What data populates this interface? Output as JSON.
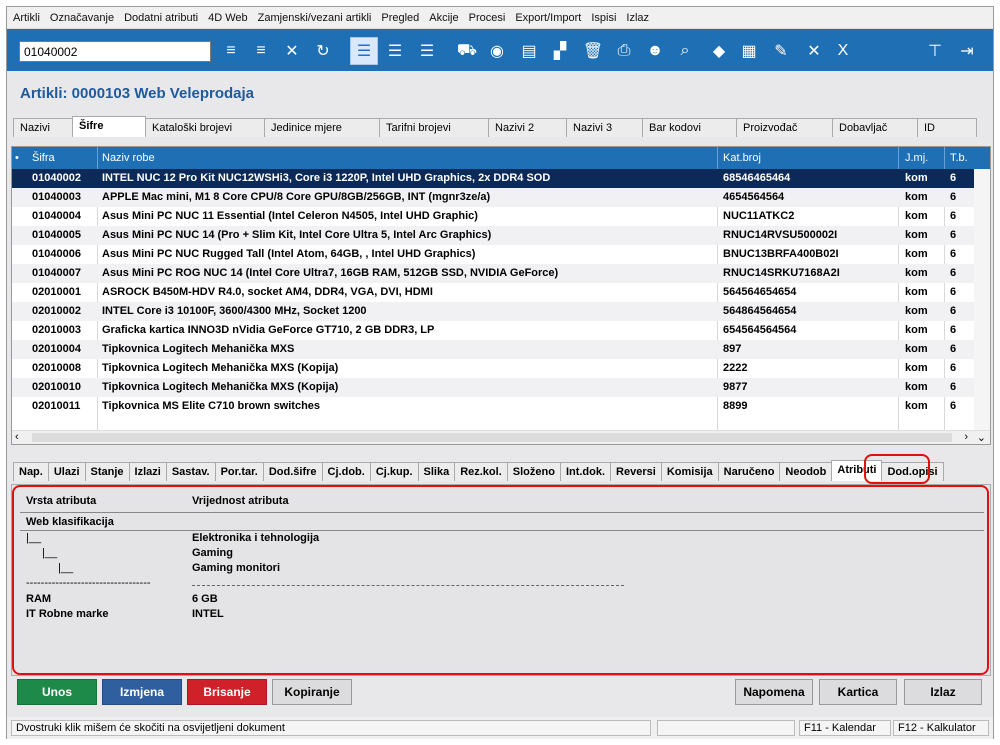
{
  "menu": [
    "Artikli",
    "Označavanje",
    "Dodatni atributi",
    "4D Web",
    "Zamjenski/vezani artikli",
    "Pregled",
    "Akcije",
    "Procesi",
    "Export/Import",
    "Ispisi",
    "Izlaz"
  ],
  "toolbar": {
    "code_value": "01040002"
  },
  "page_title": "Artikli: 0000103 Web Veleprodaja",
  "top_tabs": [
    "Nazivi",
    "Šifre",
    "Kataloški brojevi",
    "Jedinice mjere",
    "Tarifni brojevi",
    "Nazivi 2",
    "Nazivi 3",
    "Bar kodovi",
    "Proizvođač",
    "Dobavljač",
    "ID"
  ],
  "grid": {
    "headers": [
      "Šifra",
      "Naziv robe",
      "Kat.broj",
      "J.mj.",
      "T.b."
    ],
    "rows": [
      [
        "01040002",
        "INTEL NUC 12 Pro Kit NUC12WSHi3, Core i3 1220P, Intel UHD Graphics, 2x DDR4 SOD",
        "68546465464",
        "kom",
        "6"
      ],
      [
        "01040003",
        "APPLE Mac mini, M1 8 Core CPU/8 Core GPU/8GB/256GB, INT (mgnr3ze/a)",
        "4654564564",
        "kom",
        "6"
      ],
      [
        "01040004",
        "Asus Mini PC NUC 11 Essential (Intel Celeron N4505, Intel UHD Graphic)",
        "NUC11ATKC2",
        "kom",
        "6"
      ],
      [
        "01040005",
        "Asus Mini PC NUC 14 (Pro + Slim Kit, Intel Core Ultra 5, Intel Arc Graphics)",
        "RNUC14RVSU500002I",
        "kom",
        "6"
      ],
      [
        "01040006",
        "Asus Mini PC NUC Rugged Tall (Intel Atom, 64GB, , Intel UHD Graphics)",
        "BNUC13BRFA400B02I",
        "kom",
        "6"
      ],
      [
        "01040007",
        "Asus Mini PC ROG NUC 14 (Intel Core Ultra7, 16GB RAM, 512GB SSD, NVIDIA GeForce)",
        "RNUC14SRKU7168A2I",
        "kom",
        "6"
      ],
      [
        "02010001",
        "ASROCK B450M-HDV R4.0, socket AM4, DDR4, VGA, DVI, HDMI",
        "564564654654",
        "kom",
        "6"
      ],
      [
        "02010002",
        "INTEL Core i3 10100F, 3600/4300 MHz, Socket 1200",
        "564864564654",
        "kom",
        "6"
      ],
      [
        "02010003",
        "Graficka kartica INNO3D nVidia GeForce GT710, 2 GB DDR3, LP",
        "654564564564",
        "kom",
        "6"
      ],
      [
        "02010004",
        "Tipkovnica Logitech Mehanička MXS",
        "897",
        "kom",
        "6"
      ],
      [
        "02010008",
        "Tipkovnica Logitech Mehanička MXS (Kopija)",
        "2222",
        "kom",
        "6"
      ],
      [
        "02010010",
        "Tipkovnica Logitech Mehanička MXS (Kopija)",
        "9877",
        "kom",
        "6"
      ],
      [
        "02010011",
        "Tipkovnica MS Elite C710 brown switches",
        "8899",
        "kom",
        "6"
      ]
    ]
  },
  "bottom_tabs": [
    "Nap.",
    "Ulazi",
    "Stanje",
    "Izlazi",
    "Sastav.",
    "Por.tar.",
    "Dod.šifre",
    "Cj.dob.",
    "Cj.kup.",
    "Slika",
    "Rez.kol.",
    "Složeno",
    "Int.dok.",
    "Reversi",
    "Komisija",
    "Naručeno",
    "Neodob",
    "Atributi",
    "Dod.opisi"
  ],
  "attributes": {
    "col_type": "Vrsta atributa",
    "col_value": "Vrijednost atributa",
    "group": "Web klasifikacija",
    "tree": [
      {
        "marker": "|__",
        "value": "Elektronika i tehnologija"
      },
      {
        "marker": "|__",
        "value": "Gaming"
      },
      {
        "marker": "|__",
        "value": "Gaming monitori"
      }
    ],
    "dashes": "----------------------------------",
    "rows": [
      {
        "name": "RAM",
        "value": "6 GB"
      },
      {
        "name": "IT Robne marke",
        "value": "INTEL"
      }
    ]
  },
  "buttons": {
    "unos": "Unos",
    "izmjena": "Izmjena",
    "brisanje": "Brisanje",
    "kopiranje": "Kopiranje",
    "napomena": "Napomena",
    "kartica": "Kartica",
    "izlaz": "Izlaz"
  },
  "status": {
    "hint": "Dvostruki klik mišem će skočiti na osvijetljeni dokument",
    "f11": "F11 - Kalendar",
    "f12": "F12 - Kalkulator"
  },
  "colors": {
    "accent": "#1f6fb5",
    "selected_row": "#0b2a57",
    "highlight_frame": "#e01010",
    "unos": "#1e8a4a",
    "izmjena": "#2f5f9f",
    "brisanje": "#d0202a"
  }
}
